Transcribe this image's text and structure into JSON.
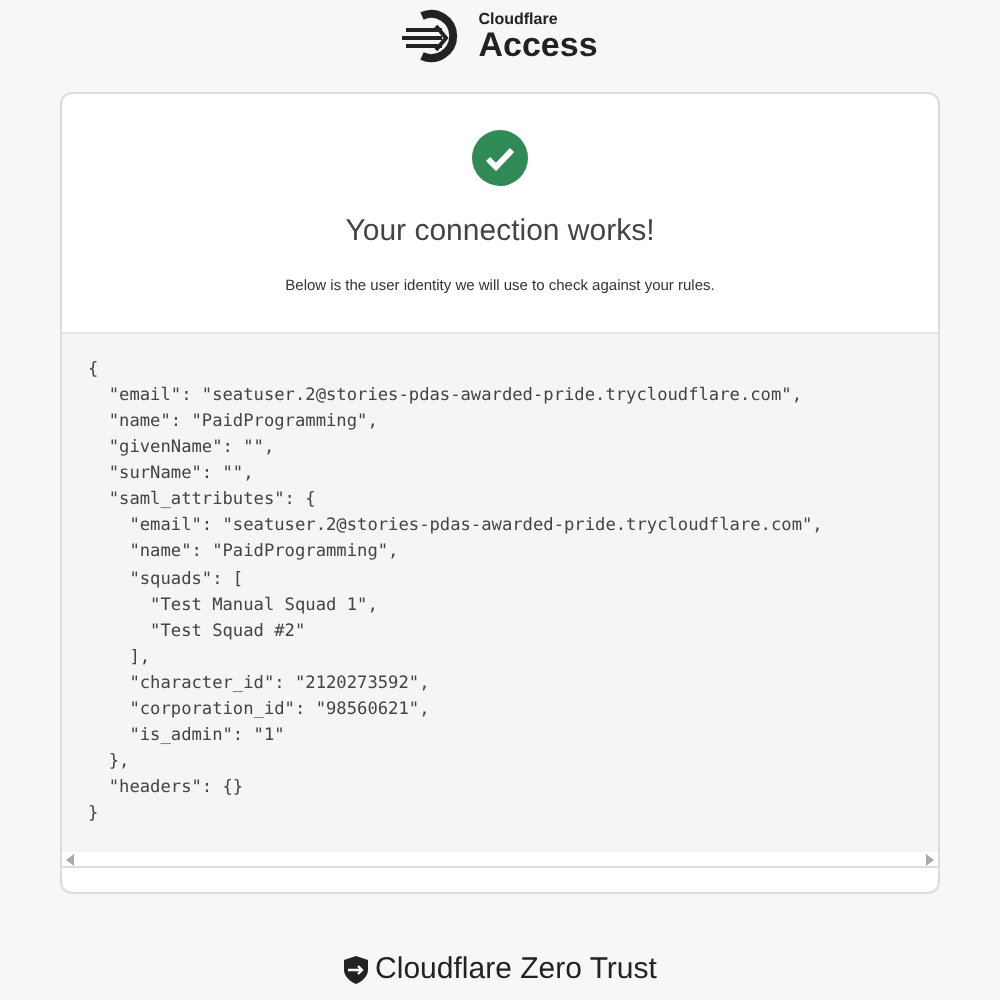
{
  "header": {
    "brand": "Cloudflare",
    "product": "Access"
  },
  "card": {
    "title": "Your connection works!",
    "subtitle": "Below is the user identity we will use to check against your rules.",
    "code_lines": [
      "{",
      "  \"email\": \"seatuser.2@stories-pdas-awarded-pride.trycloudflare.com\",",
      "  \"name\": \"PaidProgramming\",",
      "  \"givenName\": \"\",",
      "  \"surName\": \"\",",
      "  \"saml_attributes\": {",
      "    \"email\": \"seatuser.2@stories-pdas-awarded-pride.trycloudflare.com\",",
      "    \"name\": \"PaidProgramming\",",
      "    \"squads\": [",
      "      \"Test Manual Squad 1\",",
      "      \"Test Squad #2\"",
      "    ],",
      "    \"character_id\": \"2120273592\",",
      "    \"corporation_id\": \"98560621\",",
      "    \"is_admin\": \"1\"",
      "  },",
      "  \"headers\": {}",
      "}"
    ]
  },
  "footer": {
    "brand": "Cloudflare Zero Trust"
  }
}
